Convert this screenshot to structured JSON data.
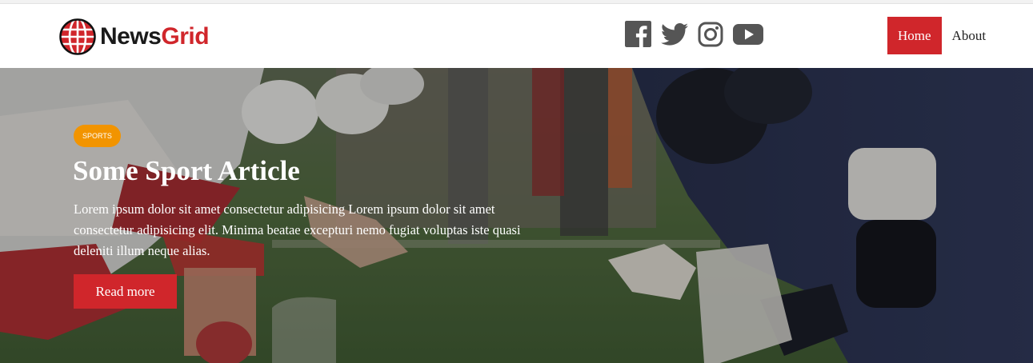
{
  "header": {
    "brand": {
      "name_part1": "News",
      "name_part2": "Grid"
    },
    "social": [
      {
        "icon": "facebook-icon"
      },
      {
        "icon": "twitter-icon"
      },
      {
        "icon": "instagram-icon"
      },
      {
        "icon": "youtube-icon"
      }
    ],
    "nav": [
      {
        "label": "Home",
        "active": true
      },
      {
        "label": "About",
        "active": false
      }
    ]
  },
  "hero": {
    "category": "SPORTS",
    "title": "Some Sport Article",
    "excerpt": "Lorem ipsum dolor sit amet consectetur adipisicing Lorem ipsum dolor sit amet consectetur adipisicing elit. Minima beatae excepturi nemo fugiat voluptas iste quasi deleniti illum neque alias.",
    "cta": "Read more"
  },
  "colors": {
    "accent": "#d0262b",
    "badge": "#f29400",
    "icon": "#555555"
  }
}
